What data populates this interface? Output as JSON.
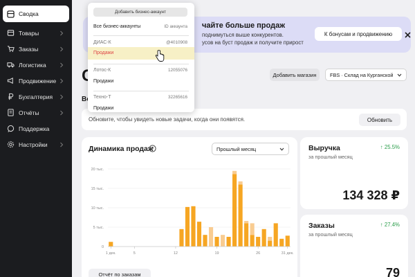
{
  "sidebar": {
    "items": [
      {
        "label": "Сводка",
        "icon": "dashboard-icon",
        "active": true,
        "chevron": false
      },
      {
        "label": "Товары",
        "icon": "box-icon",
        "chevron": true
      },
      {
        "label": "Заказы",
        "icon": "cart-icon",
        "chevron": true
      },
      {
        "label": "Логистика",
        "icon": "truck-icon",
        "chevron": true
      },
      {
        "label": "Продвижение",
        "icon": "megaphone-icon",
        "chevron": true
      },
      {
        "label": "Бухгалтерия",
        "icon": "ruble-icon",
        "chevron": true
      },
      {
        "label": "Отчёты",
        "icon": "report-icon",
        "chevron": true
      },
      {
        "label": "Поддержка",
        "icon": "chat-icon",
        "chevron": false
      },
      {
        "label": "Настройки",
        "icon": "gear-icon",
        "chevron": true
      }
    ]
  },
  "banner": {
    "title": "чайте больше продаж",
    "text1": "поднимуться выше конкурентов.",
    "text2": "усов на буст продаж и получите прирост",
    "button": "К бонусам и продвижению"
  },
  "page": {
    "title": "С",
    "section": "Во",
    "add_store": "Добавить магазин",
    "warehouse": "FBS · Склад на Курганской"
  },
  "update": {
    "text": "Обновите, чтобы увидеть новые задачи, когда они появятся.",
    "button": "Обновить"
  },
  "sales_chart": {
    "title": "Динамика продаж",
    "period": "Прошлый месяц",
    "report_button": "Отчёт по заказам"
  },
  "chart_data": {
    "type": "bar",
    "x": [
      1,
      2,
      3,
      4,
      5,
      6,
      7,
      8,
      9,
      10,
      11,
      12,
      13,
      14,
      15,
      16,
      17,
      18,
      19,
      20,
      21,
      22,
      23,
      24,
      25,
      26,
      27,
      28,
      29,
      30,
      31
    ],
    "x_tick_labels": [
      "1 дек.",
      "5",
      "12",
      "19",
      "26",
      "31 дек."
    ],
    "y_tick_labels": [
      "0",
      "5 тыс.",
      "10 тыс.",
      "15 тыс.",
      "20 тыс."
    ],
    "ylim": [
      0,
      20000
    ],
    "series": [
      {
        "values": [
          1200,
          0,
          0,
          0,
          0,
          0,
          0,
          0,
          0,
          0,
          0,
          0,
          4500,
          10200,
          10400,
          6400,
          3000,
          0,
          2500,
          0,
          2500,
          18700,
          16000,
          6000,
          3000,
          2500,
          4500,
          1500,
          6000,
          2000,
          2800
        ]
      },
      {
        "values": [
          0,
          0,
          0,
          0,
          0,
          0,
          0,
          0,
          0,
          0,
          0,
          0,
          0,
          0,
          0,
          0,
          0,
          5000,
          0,
          3000,
          0,
          800,
          800,
          600,
          3000,
          0,
          0,
          1000,
          0,
          0,
          0
        ]
      }
    ],
    "colors": {
      "primary": "#f6a623",
      "secondary": "#f9cc91",
      "axis": "#888888",
      "grid": "#e8e8e8"
    }
  },
  "revenue": {
    "title": "Выручка",
    "subtitle": "за прошлый месяц",
    "delta": "↑ 25.5%",
    "value": "134 328 ₽"
  },
  "orders": {
    "title": "Заказы",
    "subtitle": "за прошлый месяц",
    "delta": "↑ 27.4%",
    "value": "79"
  },
  "account_dropdown": {
    "add_button": "Добавить бизнес-аккаунт",
    "all_accounts": "Все бизнес-аккаунты",
    "all_accounts_id": "ID аккаунта",
    "accounts": [
      {
        "name": "ДИАС-К",
        "id": "@4010908",
        "link": "Продажи"
      },
      {
        "name": "Лотос-К",
        "id": "12055076",
        "link": "Продажи"
      },
      {
        "name": "Техно-Т",
        "id": "32265616",
        "link": "Продажи"
      }
    ]
  }
}
